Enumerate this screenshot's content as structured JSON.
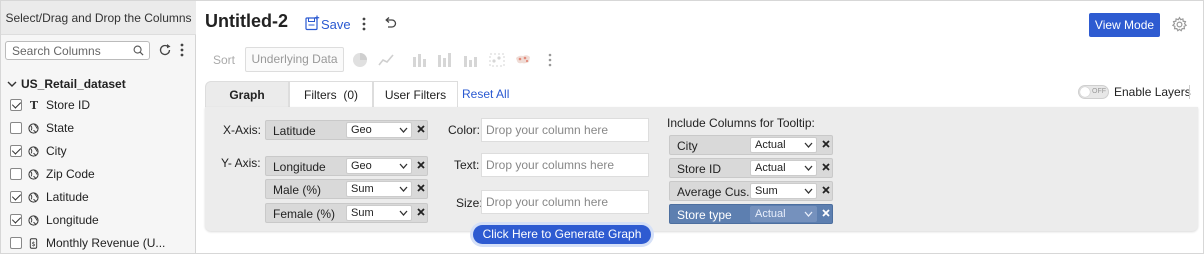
{
  "left_panel": {
    "title": "Select/Drag and Drop the Columns",
    "search_placeholder": "Search Columns",
    "dataset_name": "US_Retail_dataset",
    "columns": [
      {
        "label": "Store ID",
        "checked": true,
        "icon": "text-type-icon"
      },
      {
        "label": "State",
        "checked": false,
        "icon": "globe-icon"
      },
      {
        "label": "City",
        "checked": true,
        "icon": "globe-icon"
      },
      {
        "label": "Zip Code",
        "checked": false,
        "icon": "globe-icon"
      },
      {
        "label": "Latitude",
        "checked": true,
        "icon": "globe-icon"
      },
      {
        "label": "Longitude",
        "checked": true,
        "icon": "globe-icon"
      },
      {
        "label": "Monthly Revenue (U...",
        "checked": false,
        "icon": "currency-icon"
      }
    ]
  },
  "header": {
    "title": "Untitled-2",
    "save_label": "Save",
    "view_mode_label": "View Mode"
  },
  "toolbar": {
    "sort_label": "Sort",
    "underlying_label": "Underlying Data",
    "chart_type_icons": [
      "pie-chart-icon",
      "line-chart-icon",
      "bar-chart-icon",
      "stacked-bar-icon",
      "column-chart-icon",
      "scatter-icon",
      "map-icon"
    ]
  },
  "tabs": {
    "graph": "Graph",
    "filters": "Filters  (0)",
    "user_filters": "User Filters",
    "reset_all": "Reset All",
    "enable_layers": "Enable Layers",
    "toggle_off": "OFF"
  },
  "shelves": {
    "x_axis_label": "X-Axis:",
    "y_axis_label": "Y- Axis:",
    "color_label": "Color:",
    "text_label": "Text:",
    "size_label": "Size:",
    "x_axis": [
      {
        "name": "Latitude",
        "agg": "Geo"
      }
    ],
    "y_axis": [
      {
        "name": "Longitude",
        "agg": "Geo"
      },
      {
        "name": "Male (%)",
        "agg": "Sum"
      },
      {
        "name": "Female (%)",
        "agg": "Sum"
      }
    ],
    "color_placeholder": "Drop your column here",
    "text_placeholder": "Drop your columns here",
    "size_placeholder": "Drop your column here",
    "tooltip_title": "Include Columns for Tooltip:",
    "tooltip": [
      {
        "name": "City",
        "agg": "Actual"
      },
      {
        "name": "Store ID",
        "agg": "Actual"
      },
      {
        "name": "Average Cus...",
        "agg": "Sum"
      },
      {
        "name": "Store type",
        "agg": "Actual"
      }
    ]
  },
  "generate_label": "Click Here to Generate Graph",
  "colors": {
    "accent": "#2e5bd1",
    "highlight_chip": "#5d7fb0"
  }
}
